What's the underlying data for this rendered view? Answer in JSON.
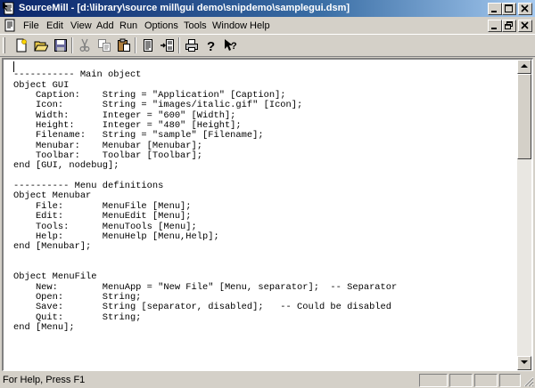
{
  "window": {
    "title": "SourceMill - [d:\\library\\source mill\\gui demo\\snipdemo\\samplegui.dsm]",
    "accent": "#0a246a"
  },
  "menu": {
    "items": [
      {
        "label": "File"
      },
      {
        "label": "Edit"
      },
      {
        "label": "View"
      },
      {
        "label": "Add"
      },
      {
        "label": "Run"
      },
      {
        "label": "Options"
      },
      {
        "label": "Tools"
      },
      {
        "label": "Window"
      },
      {
        "label": "Help"
      }
    ]
  },
  "toolbar": {
    "buttons": [
      {
        "name": "new-file",
        "icon": "new-document-icon"
      },
      {
        "name": "open-file",
        "icon": "open-folder-icon"
      },
      {
        "name": "save-file",
        "icon": "save-disk-icon"
      },
      {
        "name": "cut",
        "icon": "scissors-icon"
      },
      {
        "name": "copy",
        "icon": "copy-icon"
      },
      {
        "name": "paste",
        "icon": "paste-icon"
      },
      {
        "name": "page",
        "icon": "page-icon"
      },
      {
        "name": "insert",
        "icon": "insert-page-icon"
      },
      {
        "name": "print",
        "icon": "printer-icon"
      },
      {
        "name": "help",
        "icon": "question-icon"
      },
      {
        "name": "context-help",
        "icon": "arrow-question-icon"
      }
    ]
  },
  "editor": {
    "code": "\n----------- Main object\nObject GUI\n    Caption:    String = \"Application\" [Caption];\n    Icon:       String = \"images/italic.gif\" [Icon];\n    Width:      Integer = \"600\" [Width];\n    Height:     Integer = \"480\" [Height];\n    Filename:   String = \"sample\" [Filename];\n    Menubar:    Menubar [Menubar];\n    Toolbar:    Toolbar [Toolbar];\nend [GUI, nodebug];\n\n---------- Menu definitions\nObject Menubar\n    File:       MenuFile [Menu];\n    Edit:       MenuEdit [Menu];\n    Tools:      MenuTools [Menu];\n    Help:       MenuHelp [Menu,Help];\nend [Menubar];\n\n\nObject MenuFile\n    New:        MenuApp = \"New File\" [Menu, separator];  -- Separator\n    Open:       String;\n    Save:       String [separator, disabled];   -- Could be disabled\n    Quit:       String;\nend [Menu];"
  },
  "status": {
    "text": "For Help, Press F1"
  }
}
